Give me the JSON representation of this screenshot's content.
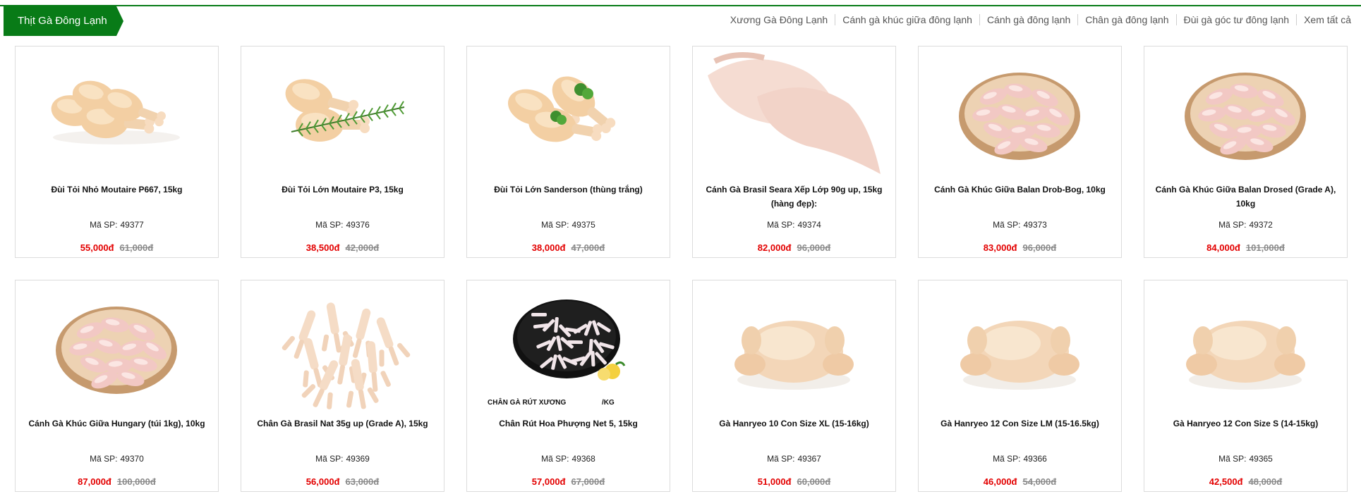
{
  "category": {
    "title": "Thịt Gà Đông Lạnh",
    "color": "#087b17"
  },
  "subnav": [
    "Xương Gà Đông Lạnh",
    "Cánh gà khúc giữa đông lạnh",
    "Cánh gà đông lạnh",
    "Chân gà đông lạnh",
    "Đùi gà góc tư đông lạnh",
    "Xem tất cả"
  ],
  "sku_label": "Mã SP:",
  "products": [
    {
      "name": "Đùi Tỏi Nhỏ Moutaire P667, 15kg",
      "sku": "49377",
      "price": "55,000đ",
      "old_price": "61,000đ",
      "image": "drumsticks"
    },
    {
      "name": "Đùi Tỏi Lớn Moutaire P3, 15kg",
      "sku": "49376",
      "price": "38,500đ",
      "old_price": "42,000đ",
      "image": "drumsticks-herb"
    },
    {
      "name": "Đùi Tỏi Lớn Sanderson (thùng trắng)",
      "sku": "49375",
      "price": "38,000đ",
      "old_price": "47,000đ",
      "image": "drumsticks-parsley"
    },
    {
      "name": "Cánh Gà Brasil Seara Xếp Lớp 90g up, 15kg (hàng đẹp):",
      "sku": "49374",
      "price": "82,000đ",
      "old_price": "96,000đ",
      "image": "wings"
    },
    {
      "name": "Cánh Gà Khúc Giữa Balan Drob-Bog, 10kg",
      "sku": "49373",
      "price": "83,000đ",
      "old_price": "96,000đ",
      "image": "wings-plate"
    },
    {
      "name": "Cánh Gà Khúc Giữa Balan Drosed (Grade A), 10kg",
      "sku": "49372",
      "price": "84,000đ",
      "old_price": "101,000đ",
      "image": "wings-plate"
    },
    {
      "name": "Cánh Gà Khúc Giữa Hungary (túi 1kg), 10kg",
      "sku": "49370",
      "price": "87,000đ",
      "old_price": "100,000đ",
      "image": "wings-plate"
    },
    {
      "name": "Chân Gà Brasil Nat 35g up (Grade A), 15kg",
      "sku": "49369",
      "price": "56,000đ",
      "old_price": "63,000đ",
      "image": "feet"
    },
    {
      "name": "Chân Rút Hoa Phượng Net 5, 15kg",
      "sku": "49368",
      "price": "57,000đ",
      "old_price": "67,000đ",
      "image": "boneless-feet",
      "image_caption_left": "CHÂN GÀ RÚT XƯƠNG",
      "image_caption_right": "/KG"
    },
    {
      "name": "Gà Hanryeo 10 Con Size XL (15-16kg)",
      "sku": "49367",
      "price": "51,000đ",
      "old_price": "60,000đ",
      "image": "whole-chicken"
    },
    {
      "name": "Gà Hanryeo 12 Con Size LM (15-16.5kg)",
      "sku": "49366",
      "price": "46,000đ",
      "old_price": "54,000đ",
      "image": "whole-chicken"
    },
    {
      "name": "Gà Hanryeo 12 Con Size S (14-15kg)",
      "sku": "49365",
      "price": "42,500đ",
      "old_price": "48,000đ",
      "image": "whole-chicken"
    }
  ]
}
